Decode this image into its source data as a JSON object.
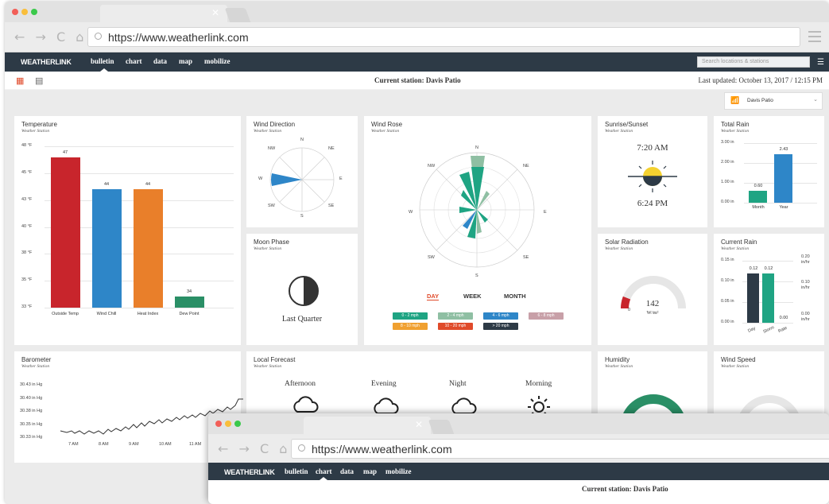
{
  "browser": {
    "url": "https://www.weatherlink.com",
    "nav_icons": "← → C ⌂",
    "tab_close": "✕"
  },
  "app": {
    "logo": "WEATHERLINK",
    "nav": [
      "bulletin",
      "chart",
      "data",
      "map",
      "mobilize"
    ],
    "active_nav": "bulletin",
    "search_placeholder": "Search locations & stations",
    "station_label": "Current station: Davis Patio",
    "last_updated": "Last updated: October 13, 2017 / 12:15 PM",
    "station_dropdown": "Davis Patio"
  },
  "colors": {
    "red": "#c8252c",
    "blue": "#2e86c8",
    "orange": "#e97f2a",
    "green": "#2a8f66",
    "teal": "#1fa483",
    "dark": "#2d3a46"
  },
  "temperature": {
    "title": "Temperature",
    "subtitle": "Weather Station",
    "yticks": [
      "48 °F",
      "45 °F",
      "43 °F",
      "40 °F",
      "38 °F",
      "35 °F",
      "33 °F"
    ],
    "bars": [
      {
        "label": "Outside Temp",
        "value": "47",
        "color": "#c8252c"
      },
      {
        "label": "Wind Chill",
        "value": "44",
        "color": "#2e86c8"
      },
      {
        "label": "Heat Index",
        "value": "44",
        "color": "#e97f2a"
      },
      {
        "label": "Dew Point",
        "value": "34",
        "color": "#2a8f66"
      }
    ]
  },
  "wind_direction": {
    "title": "Wind Direction",
    "subtitle": "Weather Station",
    "compass": [
      "N",
      "NE",
      "E",
      "SE",
      "S",
      "SW",
      "W",
      "NW"
    ]
  },
  "wind_rose": {
    "title": "Wind Rose",
    "subtitle": "Weather Station",
    "compass": [
      "N",
      "NE",
      "E",
      "SE",
      "S",
      "SW",
      "W",
      "NW"
    ],
    "tabs": [
      "DAY",
      "WEEK",
      "MONTH"
    ],
    "active_tab": "DAY",
    "legend": [
      {
        "label": "0 - 2 mph",
        "color": "#1fa483"
      },
      {
        "label": "2 - 4 mph",
        "color": "#8fbfa3"
      },
      {
        "label": "4 - 6 mph",
        "color": "#2e86c8"
      },
      {
        "label": "6 - 8 mph",
        "color": "#c8a0a8"
      },
      {
        "label": "8 - 10 mph",
        "color": "#f0a030"
      },
      {
        "label": "10 - 20 mph",
        "color": "#e04a2a"
      },
      {
        "label": "> 20 mph",
        "color": "#2d3a46"
      }
    ]
  },
  "sunrise": {
    "title": "Sunrise/Sunset",
    "subtitle": "Weather Station",
    "rise": "7:20 AM",
    "set": "6:24 PM"
  },
  "total_rain": {
    "title": "Total Rain",
    "subtitle": "Weather Station",
    "yticks": [
      "3.00 in",
      "2.00 in",
      "1.00 in",
      "0.00 in"
    ],
    "bars": [
      {
        "label": "Month",
        "value": "0.60",
        "num": 0.6,
        "color": "#1fa483"
      },
      {
        "label": "Year",
        "value": "2.43",
        "num": 2.43,
        "color": "#2e86c8"
      }
    ]
  },
  "moon": {
    "title": "Moon Phase",
    "subtitle": "Weather Station",
    "phase": "Last Quarter"
  },
  "solar": {
    "title": "Solar Radiation",
    "subtitle": "Weather Station",
    "value": "142",
    "unit": "W/m²",
    "min": "0",
    "level": 0.12
  },
  "current_rain": {
    "title": "Current Rain",
    "subtitle": "Weather Station",
    "left_ticks": [
      "0.15 in",
      "0.10 in",
      "0.05 in",
      "0.00 in"
    ],
    "right_ticks": [
      "0.20 in/hr",
      "0.10 in/hr",
      "0.00 in/hr"
    ],
    "bars": [
      {
        "label": "Day",
        "value": "0.12",
        "color": "#2d3a46"
      },
      {
        "label": "Storm",
        "value": "0.12",
        "color": "#1fa483"
      },
      {
        "label": "Rate",
        "value": "0.00",
        "color": "#2e86c8"
      }
    ]
  },
  "barometer": {
    "title": "Barometer",
    "subtitle": "Weather Station",
    "yticks": [
      "30.43 in Hg",
      "30.40 in Hg",
      "30.38 in Hg",
      "30.35 in Hg",
      "30.33 in Hg"
    ],
    "xticks": [
      "7 AM",
      "8 AM",
      "9 AM",
      "10 AM",
      "11 AM"
    ]
  },
  "forecast": {
    "title": "Local Forecast",
    "subtitle": "Weather Station",
    "periods": [
      {
        "label": "Afternoon",
        "icon": "rain-cloud-icon"
      },
      {
        "label": "Evening",
        "icon": "cloud-icon"
      },
      {
        "label": "Night",
        "icon": "cloud-icon"
      },
      {
        "label": "Morning",
        "icon": "sun-icon"
      }
    ]
  },
  "humidity": {
    "title": "Humidity",
    "subtitle": "Weather Station"
  },
  "wind_speed": {
    "title": "Wind Speed",
    "subtitle": "Weather Station"
  }
}
